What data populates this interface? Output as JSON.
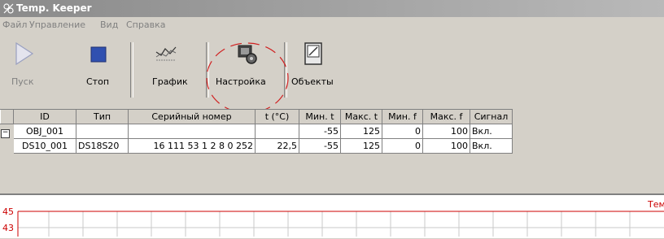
{
  "window": {
    "title": "Temp. Keeper"
  },
  "menu": [
    "Файл",
    "Управление",
    "Вид",
    "Справка"
  ],
  "toolbar": {
    "start": "Пуск",
    "stop": "Стоп",
    "graph": "График",
    "settings": "Настройка",
    "objects": "Объекты"
  },
  "table": {
    "columns": [
      "ID",
      "Тип",
      "Серийный номер",
      "t (°C)",
      "Мин. t",
      "Макс. t",
      "Мин. f",
      "Макс. f",
      "Сигнал"
    ],
    "rows": [
      {
        "expander": "−",
        "id": "OBJ_001",
        "type": "",
        "serial": "",
        "t": "",
        "min_t": "-55",
        "max_t": "125",
        "min_f": "0",
        "max_f": "100",
        "signal": "Вкл."
      },
      {
        "expander": "",
        "id": "DS10_001",
        "type": "DS18S20",
        "serial": "16 111 53 1 2 8 0 252",
        "t": "22,5",
        "min_t": "-55",
        "max_t": "125",
        "min_f": "0",
        "max_f": "100",
        "signal": "Вкл."
      }
    ]
  },
  "chart": {
    "y_ticks": [
      "45",
      "43"
    ],
    "title_fragment": "Тем",
    "colors": {
      "axis": "#cc0000",
      "grid": "#c8c8c8"
    }
  }
}
